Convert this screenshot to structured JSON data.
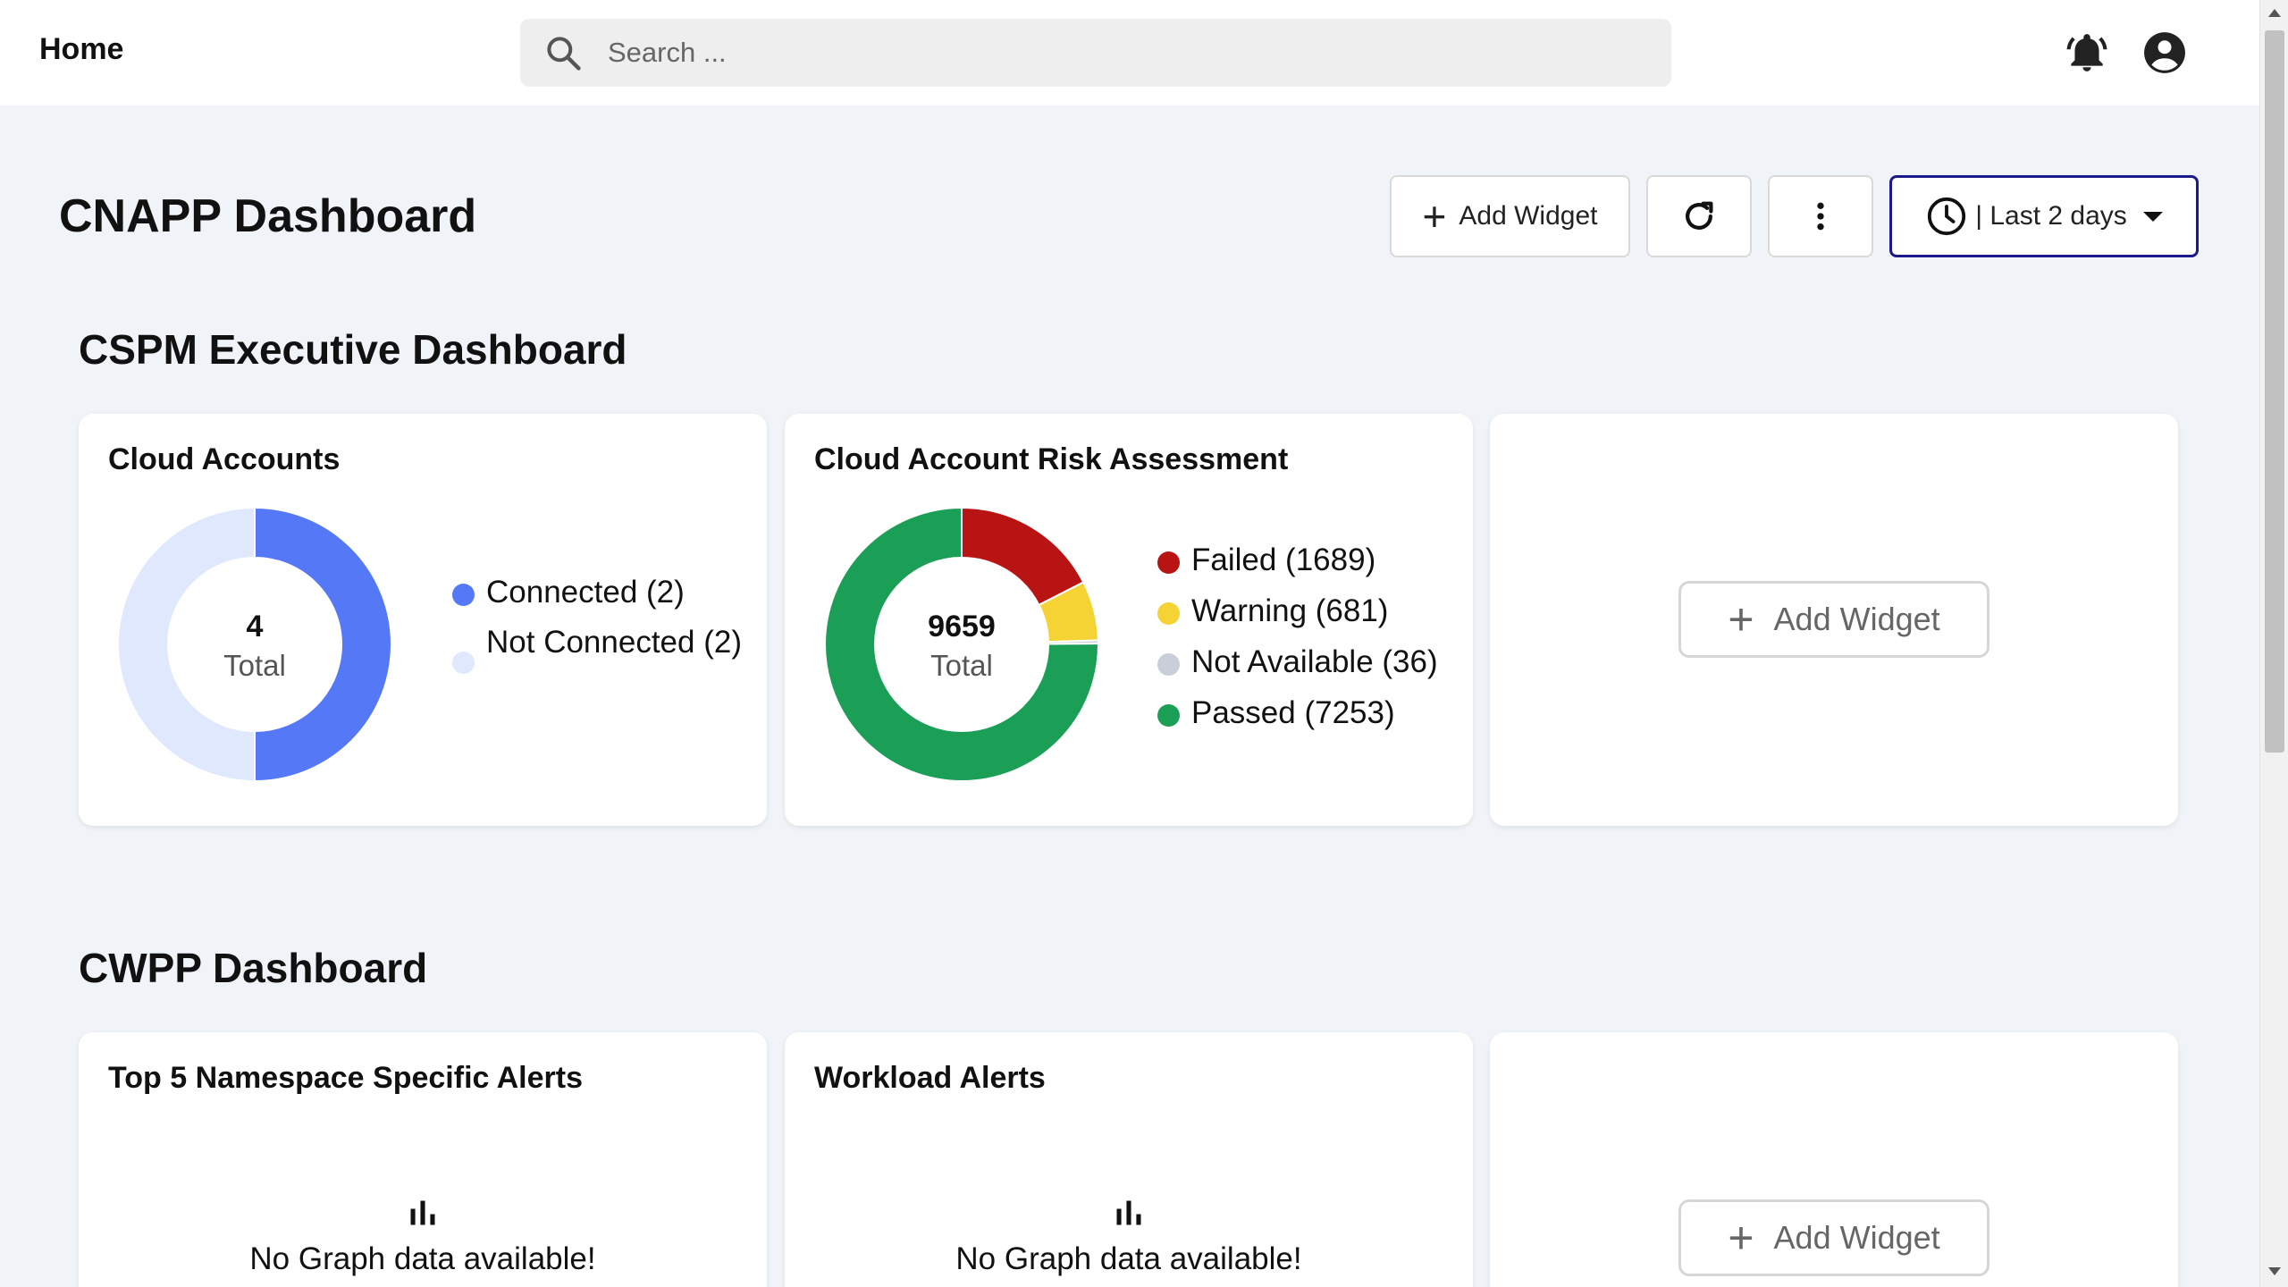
{
  "topbar": {
    "title": "Home",
    "search_placeholder": "Search ..."
  },
  "header": {
    "title": "CNAPP Dashboard",
    "add_widget_label": "Add Widget",
    "time_filter_label": "| Last 2 days"
  },
  "colors": {
    "accent_border": "#1a1a8c",
    "connected": "#5578f6",
    "not_connected": "#dfe8fd",
    "failed": "#b81414",
    "warning": "#f6d335",
    "not_available": "#c9ced8",
    "passed": "#1b9e56"
  },
  "sections": [
    {
      "title": "CSPM Executive Dashboard",
      "widgets": [
        {
          "title": "Cloud Accounts",
          "total": "4",
          "total_label": "Total",
          "legend": [
            {
              "label": "Connected (2)",
              "value": 2,
              "color": "#5578f6"
            },
            {
              "label": "Not Connected (2)",
              "value": 2,
              "color": "#dfe8fd"
            }
          ]
        },
        {
          "title": "Cloud Account Risk Assessment",
          "total": "9659",
          "total_label": "Total",
          "legend": [
            {
              "label": "Failed (1689)",
              "value": 1689,
              "color": "#b81414"
            },
            {
              "label": "Warning (681)",
              "value": 681,
              "color": "#f6d335"
            },
            {
              "label": "Not Available (36)",
              "value": 36,
              "color": "#c9ced8"
            },
            {
              "label": "Passed (7253)",
              "value": 7253,
              "color": "#1b9e56"
            }
          ]
        },
        {
          "add_widget_label": "Add Widget"
        }
      ]
    },
    {
      "title": "CWPP Dashboard",
      "widgets": [
        {
          "title": "Top 5 Namespace Specific Alerts",
          "no_data": "No Graph data available!"
        },
        {
          "title": "Workload Alerts",
          "no_data": "No Graph data available!"
        },
        {
          "add_widget_label": "Add Widget"
        }
      ]
    }
  ],
  "chart_data": [
    {
      "type": "pie",
      "title": "Cloud Accounts",
      "categories": [
        "Connected",
        "Not Connected"
      ],
      "values": [
        2,
        2
      ]
    },
    {
      "type": "pie",
      "title": "Cloud Account Risk Assessment",
      "categories": [
        "Failed",
        "Warning",
        "Not Available",
        "Passed"
      ],
      "values": [
        1689,
        681,
        36,
        7253
      ]
    }
  ]
}
